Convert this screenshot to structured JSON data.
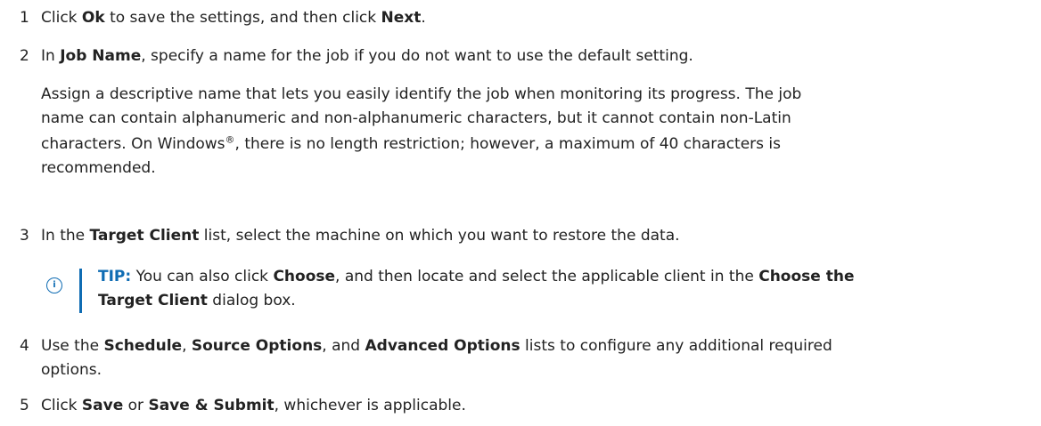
{
  "steps": [
    {
      "number": "1",
      "parts": [
        "Click ",
        "Ok",
        " to save the settings, and then click ",
        "Next",
        "."
      ]
    },
    {
      "number": "2",
      "parts": [
        "In ",
        "Job Name",
        ", specify a name for the job if you do not want to use the default setting."
      ],
      "description": {
        "line1": "Assign a descriptive name that lets you easily identify the job when monitoring its progress. The job",
        "line2": "name can contain alphanumeric and non-alphanumeric characters, but it cannot contain non-Latin",
        "line3_a": "characters. On Windows",
        "registered": "®",
        "line3_b": ", there is no length restriction; however, a maximum of 40 characters is",
        "line4": "recommended."
      }
    },
    {
      "number": "3",
      "parts": [
        "In the ",
        "Target Client",
        " list, select the machine on which you want to restore the data."
      ],
      "tip": {
        "icon": "info-circle-icon",
        "label": "TIP:",
        "line1_parts": [
          " You can also click ",
          "Choose",
          ", and then locate and select the applicable client in the ",
          "Choose the"
        ],
        "line2_parts": [
          "Target Client",
          " dialog box."
        ]
      }
    },
    {
      "number": "4",
      "parts": [
        "Use the ",
        "Schedule",
        ", ",
        "Source Options",
        ", and ",
        "Advanced Options",
        " lists to configure any additional required"
      ],
      "continuation": "options."
    },
    {
      "number": "5",
      "parts": [
        "Click ",
        "Save",
        " or ",
        "Save & Submit",
        ", whichever is applicable."
      ]
    }
  ],
  "colors": {
    "text": "#222222",
    "accent": "#0f6cb3"
  }
}
